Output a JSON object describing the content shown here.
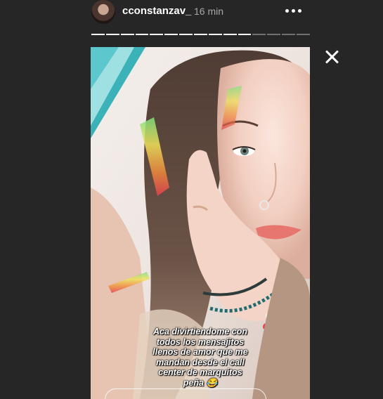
{
  "header": {
    "username": "cconstanzav_",
    "time": "16 min"
  },
  "progress": {
    "total_segments": 15,
    "completed_segments": 11
  },
  "story": {
    "caption": "Aca divirtiendome con\ntodos los mensajitos\nllenos de amor que me\nmandan desde el call\ncenter de marquitos\npeña 😂"
  },
  "icons": {
    "more": "more-options-icon",
    "close": "close-icon"
  },
  "colors": {
    "background": "#262626",
    "secondary_text": "#a8a8a8"
  }
}
